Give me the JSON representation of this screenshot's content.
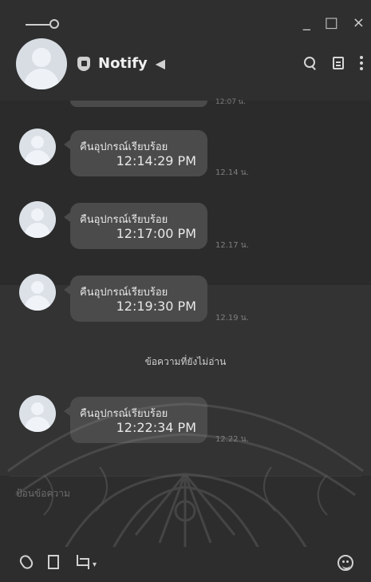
{
  "window": {
    "controls": [
      "_",
      "□",
      "×"
    ]
  },
  "header": {
    "title": "Notify",
    "icons": {
      "search": "search-icon",
      "note": "note-icon",
      "more": "more-icon",
      "shield": "shield-icon",
      "speaker": "speaker-icon"
    }
  },
  "chat": {
    "partial_time": "12:07 น.",
    "messages": [
      {
        "text": "คืนอุปกรณ์เรียบร้อย",
        "bubble_time": "12:14:29 PM",
        "meta_time": "12.14 น."
      },
      {
        "text": "คืนอุปกรณ์เรียบร้อย",
        "bubble_time": "12:17:00 PM",
        "meta_time": "12.17 น."
      },
      {
        "text": "คืนอุปกรณ์เรียบร้อย",
        "bubble_time": "12:19:30 PM",
        "meta_time": "12.19 น."
      },
      {
        "text": "คืนอุปกรณ์เรียบร้อย",
        "bubble_time": "12:22:34 PM",
        "meta_time": "12.22 น."
      }
    ],
    "unread_label": "ข้อความที่ยังไม่อ่าน"
  },
  "composer": {
    "placeholder": "ป้อนข้อความ"
  },
  "bottom_icons": {
    "attach": "paperclip-icon",
    "bookmark": "bookmark-icon",
    "crop": "crop-icon",
    "emoji": "emoji-icon"
  }
}
